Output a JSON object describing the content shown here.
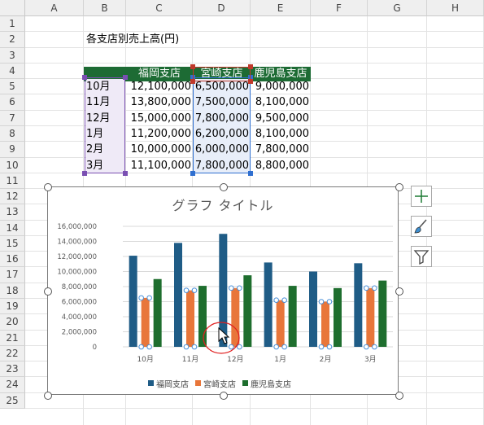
{
  "columns": [
    "A",
    "B",
    "C",
    "D",
    "E",
    "F",
    "G",
    "H"
  ],
  "rows": [
    "1",
    "2",
    "3",
    "4",
    "5",
    "6",
    "7",
    "8",
    "9",
    "10",
    "11",
    "12",
    "13",
    "14",
    "15",
    "16",
    "17",
    "18",
    "19",
    "20",
    "21",
    "22",
    "23",
    "24",
    "25"
  ],
  "sheet": {
    "title": "各支店別売上高(円)",
    "headers": [
      "福岡支店",
      "宮崎支店",
      "鹿児島支店"
    ],
    "table": [
      {
        "month": "10月",
        "fukuoka": "12,100,000",
        "miyazaki": "6,500,000",
        "kagoshima": "9,000,000"
      },
      {
        "month": "11月",
        "fukuoka": "13,800,000",
        "miyazaki": "7,500,000",
        "kagoshima": "8,100,000"
      },
      {
        "month": "12月",
        "fukuoka": "15,000,000",
        "miyazaki": "7,800,000",
        "kagoshima": "9,500,000"
      },
      {
        "month": "1月",
        "fukuoka": "11,200,000",
        "miyazaki": "6,200,000",
        "kagoshima": "8,100,000"
      },
      {
        "month": "2月",
        "fukuoka": "10,000,000",
        "miyazaki": "6,000,000",
        "kagoshima": "7,800,000"
      },
      {
        "month": "3月",
        "fukuoka": "11,100,000",
        "miyazaki": "7,800,000",
        "kagoshima": "8,800,000"
      }
    ]
  },
  "chart_data": {
    "type": "bar",
    "title": "グラフ タイトル",
    "categories": [
      "10月",
      "11月",
      "12月",
      "1月",
      "2月",
      "3月"
    ],
    "series": [
      {
        "name": "福岡支店",
        "color": "#1f5c86",
        "values": [
          12100000,
          13800000,
          15000000,
          11200000,
          10000000,
          11100000
        ]
      },
      {
        "name": "宮崎支店",
        "color": "#e8763a",
        "values": [
          6500000,
          7500000,
          7800000,
          6200000,
          6000000,
          7800000
        ]
      },
      {
        "name": "鹿児島支店",
        "color": "#1e6e2e",
        "values": [
          9000000,
          8100000,
          9500000,
          8100000,
          7800000,
          8800000
        ]
      }
    ],
    "ylim": [
      0,
      16000000
    ],
    "yticks": [
      "0",
      "2,000,000",
      "4,000,000",
      "6,000,000",
      "8,000,000",
      "10,000,000",
      "12,000,000",
      "14,000,000",
      "16,000,000"
    ],
    "grid": true,
    "legend": "bottom",
    "selected_series": "宮崎支店"
  },
  "chart_buttons": [
    "plus-icon",
    "brush-icon",
    "filter-icon"
  ],
  "colors": {
    "header_green": "#1d6b34",
    "selection_blue": "#2f6fd0",
    "selection_purple": "#7a4fb2",
    "selection_red": "#c0392b",
    "cursor_circle": "#e02020"
  }
}
